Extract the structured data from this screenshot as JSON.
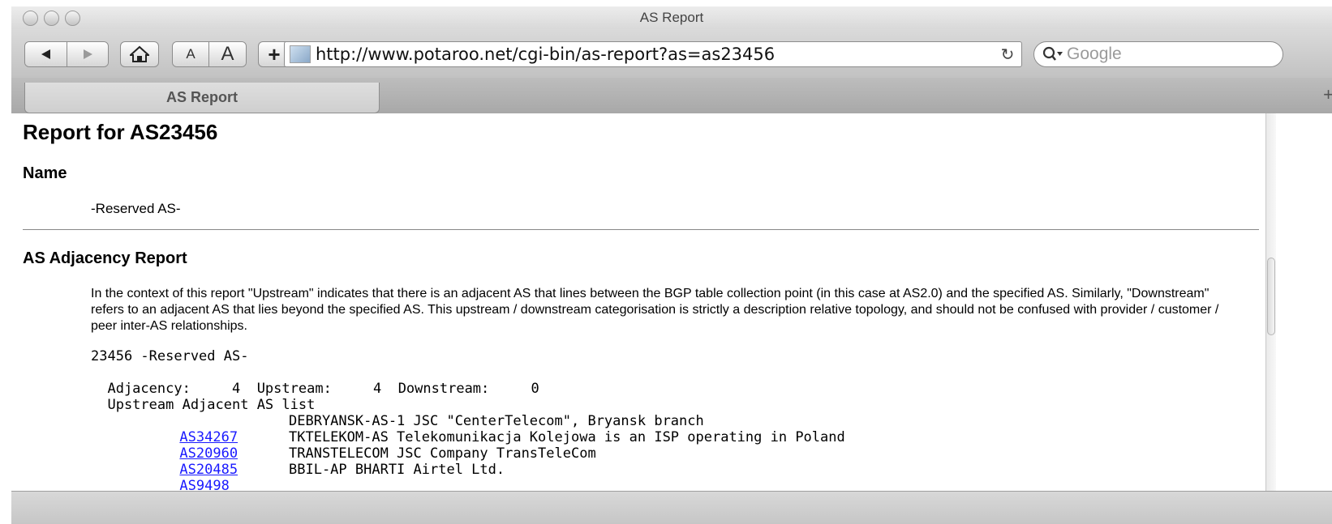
{
  "window": {
    "title": "AS Report"
  },
  "toolbar": {
    "font_small": "A",
    "font_large": "A",
    "url": "http://www.potaroo.net/cgi-bin/as-report?as=as23456",
    "search_placeholder": "Google"
  },
  "tabs": [
    {
      "label": "AS Report"
    }
  ],
  "page": {
    "heading": "Report for AS23456",
    "name_section": {
      "heading": "Name",
      "value": "-Reserved AS-"
    },
    "adjacency_section": {
      "heading": "AS Adjacency Report",
      "description": "In the context of this report \"Upstream\" indicates that there is an adjacent AS that lines between the BGP table collection point (in this case at AS2.0) and the specified AS. Similarly, \"Downstream\" refers to an adjacent AS that lies beyond the specified AS. This upstream / downstream categorisation is strictly a description relative topology, and should not be confused with provider / customer / peer inter-AS relationships.",
      "as_line": "23456 -Reserved AS-",
      "counts_line": "  Adjacency:     4  Upstream:     4  Downstream:     0",
      "list_heading": "  Upstream Adjacent AS list",
      "upstream": [
        {
          "as": "AS34267",
          "desc": "DEBRYANSK-AS-1 JSC \"CenterTelecom\", Bryansk branch"
        },
        {
          "as": "AS20960",
          "desc": "TKTELEKOM-AS Telekomunikacja Kolejowa is an ISP operating in Poland"
        },
        {
          "as": "AS20485",
          "desc": "TRANSTELECOM JSC Company TransTeleCom"
        },
        {
          "as": "AS9498",
          "desc": "BBIL-AP BHARTI Airtel Ltd."
        }
      ]
    }
  }
}
